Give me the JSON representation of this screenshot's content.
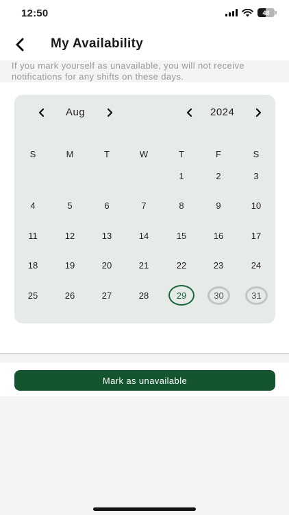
{
  "status_bar": {
    "time": "12:50",
    "battery": "48"
  },
  "header": {
    "title": "My Availability",
    "back_icon": "chevron-left-icon"
  },
  "info": {
    "text": "If you mark yourself as unavailable, you will not receive notifications for any shifts on these days."
  },
  "calendar": {
    "month": "Aug",
    "year": "2024",
    "weekdays": [
      "S",
      "M",
      "T",
      "W",
      "T",
      "F",
      "S"
    ],
    "weeks": [
      [
        "",
        "",
        "",
        "",
        "1",
        "2",
        "3"
      ],
      [
        "4",
        "5",
        "6",
        "7",
        "8",
        "9",
        "10"
      ],
      [
        "11",
        "12",
        "13",
        "14",
        "15",
        "16",
        "17"
      ],
      [
        "18",
        "19",
        "20",
        "21",
        "22",
        "23",
        "24"
      ],
      [
        "25",
        "26",
        "27",
        "28",
        "29",
        "30",
        "31"
      ]
    ],
    "selected_day": "29",
    "marked_days": [
      "30",
      "31"
    ],
    "colors": {
      "accent": "#15663a",
      "calendar_bg": "#e6ebe7",
      "marked_ring": "#c4c4c4"
    }
  },
  "actions": {
    "mark_unavailable_label": "Mark as unavailable",
    "button_color": "#14552f"
  }
}
